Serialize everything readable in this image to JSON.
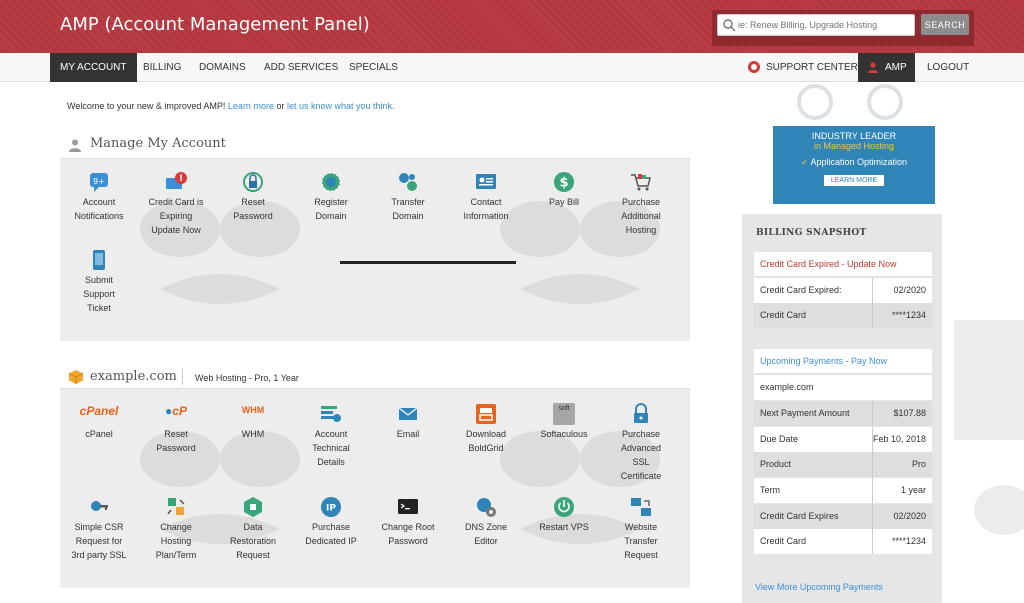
{
  "header": {
    "title": "AMP (Account Management Panel)",
    "search_placeholder": "ie: Renew Billing, Upgrade Hosting",
    "search_button": "SEARCH"
  },
  "nav": {
    "left": [
      "MY ACCOUNT",
      "BILLING",
      "DOMAINS",
      "ADD SERVICES",
      "SPECIALS"
    ],
    "support": "SUPPORT CENTER",
    "amp": "AMP",
    "logout": "LOGOUT"
  },
  "welcome": {
    "text": "Welcome to your new & improved AMP!",
    "learn": "Learn more",
    "or": "or",
    "let": "let us know what you think."
  },
  "manage": {
    "title": "Manage My Account",
    "tiles": [
      {
        "label": [
          "Account",
          "Notifications"
        ],
        "icon": "notifications-badge-icon",
        "badge": "9+"
      },
      {
        "label": [
          "Credit Card is",
          "Expiring",
          "Update Now"
        ],
        "icon": "credit-card-alert-icon"
      },
      {
        "label": [
          "Reset",
          "Password"
        ],
        "icon": "lock-reset-icon"
      },
      {
        "label": [
          "Register",
          "Domain"
        ],
        "icon": "globe-register-icon"
      },
      {
        "label": [
          "Transfer",
          "Domain"
        ],
        "icon": "globe-transfer-icon"
      },
      {
        "label": [
          "Contact",
          "Information"
        ],
        "icon": "contact-card-icon"
      },
      {
        "label": [
          "Pay Bill"
        ],
        "icon": "dollar-icon"
      },
      {
        "label": [
          "Purchase",
          "Additional",
          "Hosting"
        ],
        "icon": "cart-icon"
      },
      {
        "label": [
          "Submit",
          "Support",
          "Ticket"
        ],
        "icon": "support-ticket-icon"
      }
    ]
  },
  "domain": {
    "name": "example.com",
    "plan": "Web Hosting - Pro, 1 Year",
    "tiles": [
      {
        "label": [
          "cPanel"
        ],
        "icon": "cpanel-logo-icon",
        "logo_text": "cPanel"
      },
      {
        "label": [
          "Reset",
          "Password"
        ],
        "icon": "cpanel-reset-icon",
        "logo_text": "cP"
      },
      {
        "label": [
          "WHM"
        ],
        "icon": "whm-logo-icon",
        "logo_text": "WHM"
      },
      {
        "label": [
          "Account",
          "Technical",
          "Details"
        ],
        "icon": "technical-details-icon"
      },
      {
        "label": [
          "Email"
        ],
        "icon": "envelope-icon"
      },
      {
        "label": [
          "Download",
          "BoldGrid"
        ],
        "icon": "boldgrid-icon"
      },
      {
        "label": [
          "Softaculous"
        ],
        "icon": "softaculous-icon",
        "logo_text": "soft"
      },
      {
        "label": [
          "Purchase",
          "Advanced",
          "SSL",
          "Certificate"
        ],
        "icon": "ssl-lock-icon"
      },
      {
        "label": [
          "Simple CSR",
          "Request for",
          "3rd party SSL"
        ],
        "icon": "key-icon"
      },
      {
        "label": [
          "Change",
          "Hosting",
          "Plan/Term"
        ],
        "icon": "change-plan-icon"
      },
      {
        "label": [
          "Data",
          "Restoration",
          "Request"
        ],
        "icon": "data-restore-icon"
      },
      {
        "label": [
          "Purchase",
          "Dedicated IP"
        ],
        "icon": "ip-globe-icon",
        "logo_text": "IP"
      },
      {
        "label": [
          "Change Root",
          "Password"
        ],
        "icon": "terminal-icon"
      },
      {
        "label": [
          "DNS Zone",
          "Editor"
        ],
        "icon": "dns-gear-icon"
      },
      {
        "label": [
          "Restart VPS"
        ],
        "icon": "power-icon"
      },
      {
        "label": [
          "Website",
          "Transfer",
          "Request"
        ],
        "icon": "website-transfer-icon"
      }
    ]
  },
  "promo": {
    "line1": "INDUSTRY LEADER",
    "line2": "in Managed Hosting",
    "line3": "Application Optimization",
    "button": "LEARN MORE"
  },
  "snapshot": {
    "title": "BILLING SNAPSHOT",
    "cc_alert": "Credit Card Expired - Update Now",
    "cc_expired_label": "Credit Card Expired:",
    "cc_expired_value": "02/2020",
    "cc_label": "Credit Card",
    "cc_value": "****1234",
    "upcoming": "Upcoming Payments - Pay Now",
    "domain": "example.com",
    "rows": [
      {
        "label": "Next Payment Amount",
        "value": "$107.88"
      },
      {
        "label": "Due Date",
        "value": "Feb 10, 2018"
      },
      {
        "label": "Product",
        "value": "Pro"
      },
      {
        "label": "Term",
        "value": "1 year"
      },
      {
        "label": "Credit Card Expires",
        "value": "02/2020"
      },
      {
        "label": "Credit Card",
        "value": "****1234"
      }
    ],
    "view_more": "View More Upcoming Payments"
  },
  "colors": {
    "header": "#b5373f",
    "nav_active": "#333333",
    "link": "#3a8fd6",
    "alert": "#c0392b"
  }
}
